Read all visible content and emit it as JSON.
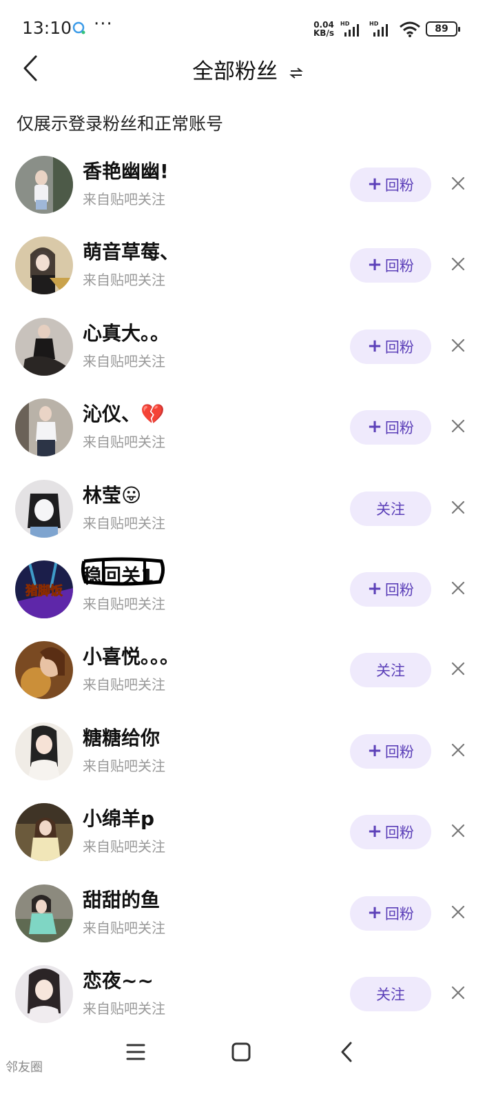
{
  "status_bar": {
    "time": "13:10",
    "network_speed_value": "0.04",
    "network_speed_unit": "KB/s",
    "battery": "89",
    "icons": [
      "chat-bubble-icon",
      "more-dots-icon",
      "signal-icon",
      "wifi-icon",
      "battery-icon"
    ]
  },
  "header": {
    "title": "全部粉丝",
    "back_icon": "chevron-left-icon",
    "switch_icon": "swap-arrows-icon"
  },
  "notice": "仅展示登录粉丝和正常账号",
  "followers": [
    {
      "name": "香艳幽幽!",
      "source": "来自贴吧关注",
      "action": "回粉",
      "has_plus": true
    },
    {
      "name": "萌音草莓、",
      "source": "来自贴吧关注",
      "action": "回粉",
      "has_plus": true
    },
    {
      "name": "心真大。。",
      "source": "来自贴吧关注",
      "action": "回粉",
      "has_plus": true
    },
    {
      "name": "沁仪、💔",
      "source": "来自贴吧关注",
      "action": "回粉",
      "has_plus": true
    },
    {
      "name": "林莹😛",
      "source": "来自贴吧关注",
      "action": "关注",
      "has_plus": false
    },
    {
      "name": "稳回关1",
      "source": "来自贴吧关注",
      "action": "回粉",
      "has_plus": true,
      "avatar_text": "猪脚饭"
    },
    {
      "name": "小喜悦。。。",
      "source": "来自贴吧关注",
      "action": "关注",
      "has_plus": false
    },
    {
      "name": "糖糖给你",
      "source": "来自贴吧关注",
      "action": "回粉",
      "has_plus": true
    },
    {
      "name": "小绵羊p",
      "source": "来自贴吧关注",
      "action": "回粉",
      "has_plus": true
    },
    {
      "name": "甜甜的鱼",
      "source": "来自贴吧关注",
      "action": "回粉",
      "has_plus": true
    },
    {
      "name": "恋夜~~",
      "source": "来自贴吧关注",
      "action": "关注",
      "has_plus": false
    }
  ],
  "plus_symbol": "+",
  "colors": {
    "button_bg": "#efeafc",
    "button_text": "#5b3fb8",
    "source_text": "#999999"
  },
  "nav_bar": {
    "icons": [
      "menu-icon",
      "home-icon",
      "back-icon"
    ]
  },
  "watermark": "邻友圈"
}
